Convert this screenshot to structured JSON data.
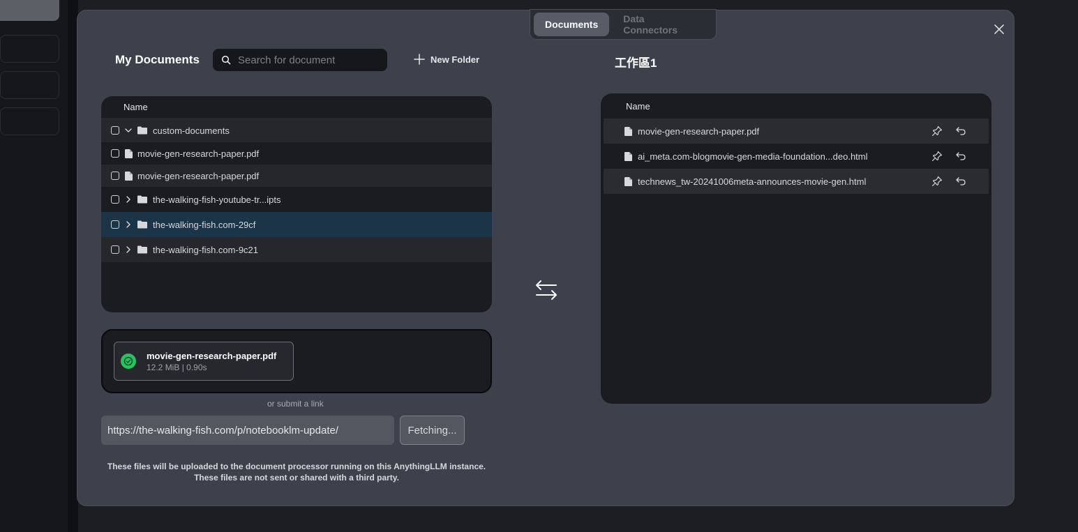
{
  "tabs": [
    {
      "label": "Documents",
      "active": true
    },
    {
      "label": "Data Connectors",
      "active": false
    }
  ],
  "left": {
    "title": "My Documents",
    "search_placeholder": "Search for document",
    "new_folder_label": "New Folder",
    "column_name": "Name",
    "rows": [
      {
        "name": "custom-documents",
        "type": "folder",
        "expanded": true
      },
      {
        "name": "movie-gen-research-paper.pdf",
        "type": "file"
      },
      {
        "name": "movie-gen-research-paper.pdf",
        "type": "file"
      },
      {
        "name": "the-walking-fish-youtube-tr...ipts",
        "type": "folder",
        "expanded": false
      },
      {
        "name": "the-walking-fish.com-29cf",
        "type": "folder",
        "expanded": false,
        "selected": true
      },
      {
        "name": "the-walking-fish.com-9c21",
        "type": "folder",
        "expanded": false
      }
    ]
  },
  "right": {
    "title": "工作區1",
    "column_name": "Name",
    "rows": [
      {
        "name": "movie-gen-research-paper.pdf"
      },
      {
        "name": "ai_meta.com-blogmovie-gen-media-foundation...deo.html"
      },
      {
        "name": "technews_tw-20241006meta-announces-movie-gen.html"
      }
    ]
  },
  "upload": {
    "file_name": "movie-gen-research-paper.pdf",
    "file_meta": "12.2 MiB | 0.90s",
    "or_link": "or submit a link",
    "url_value": "https://the-walking-fish.com/p/notebooklm-update/",
    "fetch_label": "Fetching...",
    "note_line1": "These files will be uploaded to the document processor running on this AnythingLLM instance.",
    "note_line2": "These files are not sent or shared with a third party."
  },
  "colors": {
    "modal_bg": "#3d414b",
    "panel_bg": "#1b1c20",
    "selected_row": "#1b3447",
    "success": "#22c55e"
  }
}
